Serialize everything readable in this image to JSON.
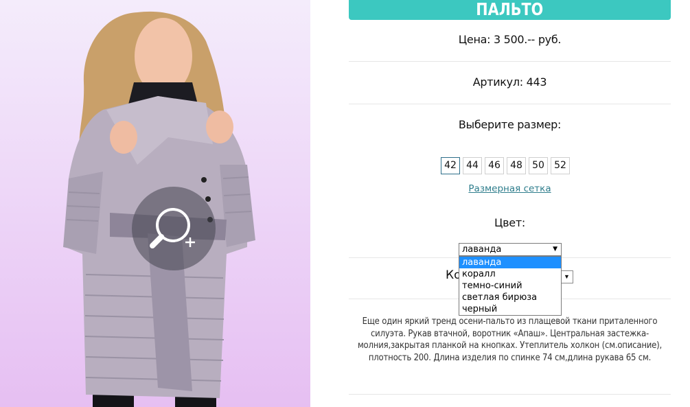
{
  "product": {
    "title": "ПАЛЬТО",
    "price_label": "Цена: 3 500.-- руб.",
    "sku_label": "Артикул: 443",
    "choose_size_label": "Выберите размер:",
    "sizes": [
      "42",
      "44",
      "46",
      "48",
      "50",
      "52"
    ],
    "selected_size": "42",
    "size_chart_link": "Размерная сетка",
    "color_label": "Цвет:",
    "color_select": {
      "value": "лаванда",
      "options": [
        "лаванда",
        "коралл",
        "темно-синий",
        "светлая бирюза",
        "черный"
      ]
    },
    "quantity_label": "Ко",
    "description": "Еще один яркий тренд осени-пальто из плащевой ткани приталенного силуэта. Рукав втачной, воротник «Апаш». Центральная застежка-молния,закрытая планкой на кнопках. Утеплитель холкон (см.описание), плотность 200. Длина изделия по спинке 74 см,длина рукава 65 см."
  },
  "colors": {
    "accent": "#3cc8c0",
    "link": "#2e7d8c",
    "selected_option": "#1e90ff"
  },
  "icons": {
    "zoom": "zoom-in-icon",
    "dropdown_arrow": "triangle-down-icon"
  }
}
